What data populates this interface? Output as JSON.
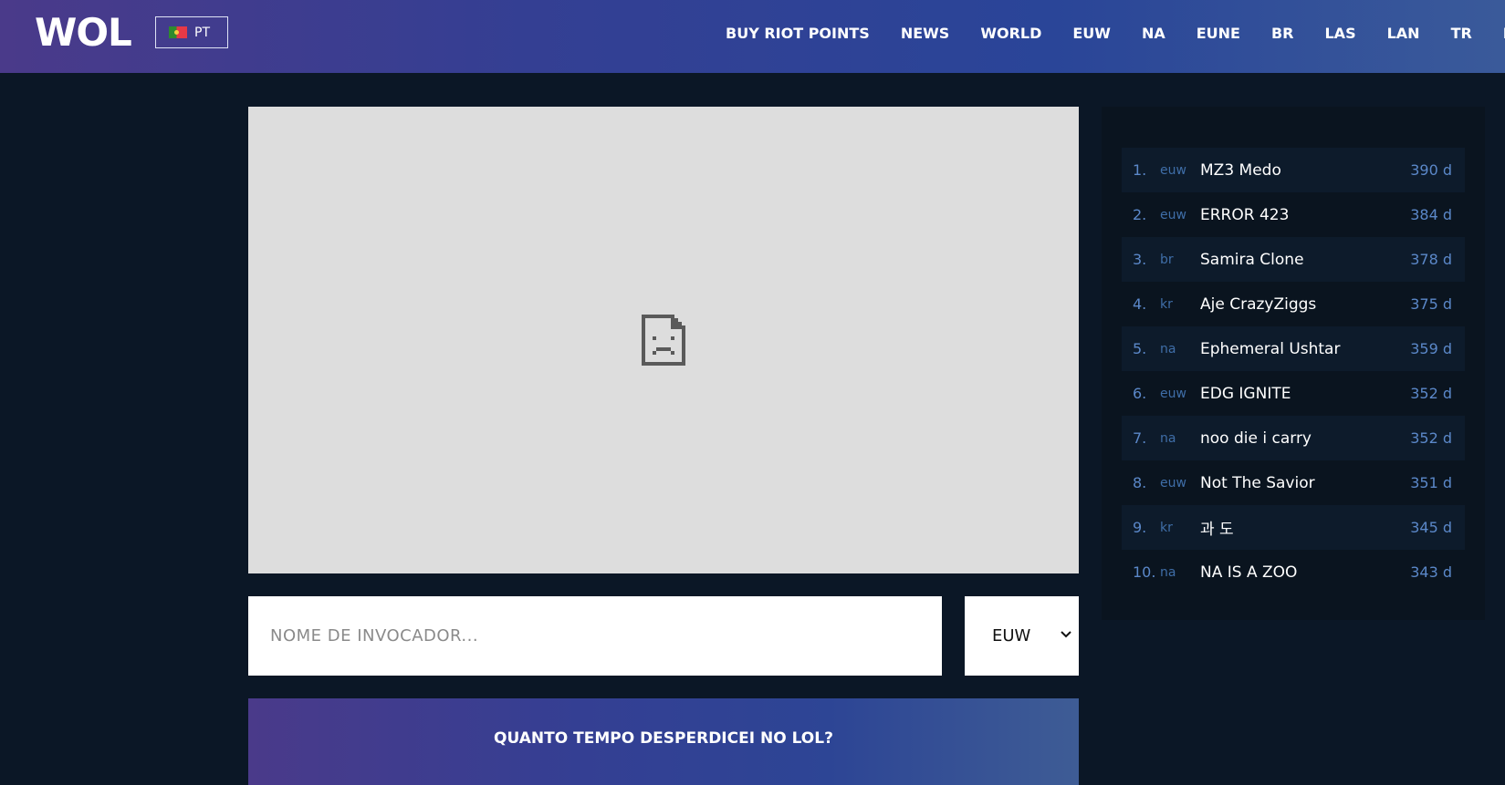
{
  "header": {
    "logo": "WOL",
    "language": "PT",
    "nav": [
      "BUY RIOT POINTS",
      "NEWS",
      "WORLD",
      "EUW",
      "NA",
      "EUNE",
      "BR",
      "LAS",
      "LAN",
      "TR",
      "R"
    ]
  },
  "search": {
    "placeholder": "NOME DE INVOCADOR...",
    "region": "EUW",
    "cta_label": "QUANTO TEMPO DESPERDICEI NO LOL?"
  },
  "leaderboard": [
    {
      "rank": "1.",
      "region": "euw",
      "name": "MZ3 Medo",
      "days": "390 d"
    },
    {
      "rank": "2.",
      "region": "euw",
      "name": "ERROR 423",
      "days": "384 d"
    },
    {
      "rank": "3.",
      "region": "br",
      "name": "Samira Clone",
      "days": "378 d"
    },
    {
      "rank": "4.",
      "region": "kr",
      "name": "Aje CrazyZiggs",
      "days": "375 d"
    },
    {
      "rank": "5.",
      "region": "na",
      "name": "Ephemeral Ushtar",
      "days": "359 d"
    },
    {
      "rank": "6.",
      "region": "euw",
      "name": "EDG IGNITE",
      "days": "352 d"
    },
    {
      "rank": "7.",
      "region": "na",
      "name": "noo die i carry",
      "days": "352 d"
    },
    {
      "rank": "8.",
      "region": "euw",
      "name": "Not The Savior",
      "days": "351 d"
    },
    {
      "rank": "9.",
      "region": "kr",
      "name": "과 도",
      "days": "345 d"
    },
    {
      "rank": "10.",
      "region": "na",
      "name": "NA IS A ZOO",
      "days": "343 d"
    }
  ],
  "icons": {
    "broken_image": "broken-image-icon",
    "flag": "portugal-flag-icon",
    "select_arrow": "chevron-down-icon"
  },
  "colors": {
    "background": "#0b1726",
    "accent": "#5b88c9",
    "header_gradient_start": "#4a3a8a",
    "header_gradient_end": "#3a5a9a"
  }
}
